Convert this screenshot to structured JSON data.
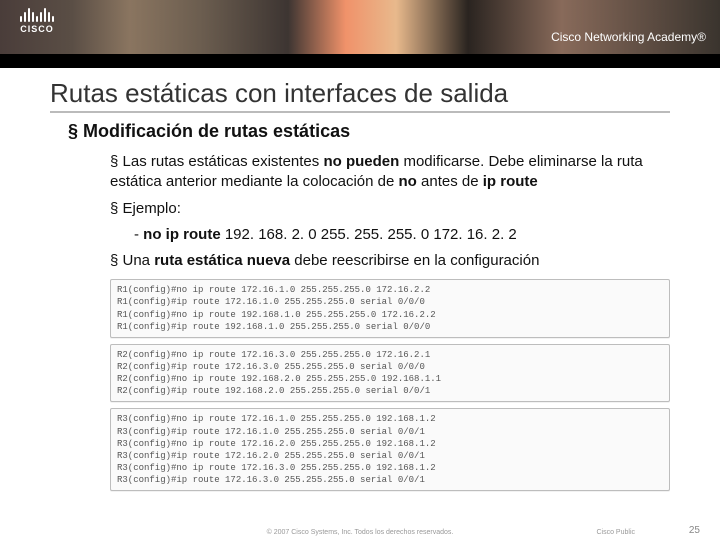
{
  "banner": {
    "logo_text": "CISCO",
    "academy": "Cisco Networking Academy®"
  },
  "slide": {
    "title": "Rutas estáticas con interfaces de salida",
    "subtitle": "Modificación de rutas estáticas"
  },
  "bullets": {
    "b1_prefix": "§ Las rutas estáticas existentes ",
    "b1_bold1": "no pueden",
    "b1_mid": " modificarse. Debe eliminarse la ruta estática anterior mediante la colocación de ",
    "b1_bold2": "no",
    "b1_mid2": " antes de ",
    "b1_bold3": "ip route",
    "b2": "§ Ejemplo:",
    "b2_sub_dash": "- ",
    "b2_sub_cmd": "no ip route",
    "b2_sub_rest": " 192. 168. 2. 0 255. 255. 255. 0 172. 16. 2. 2",
    "b3_prefix": "§ Una ",
    "b3_bold": "ruta estática nueva",
    "b3_rest": " debe reescribirse en la configuración"
  },
  "terminals": [
    [
      "R1(config)#no ip route 172.16.1.0 255.255.255.0 172.16.2.2",
      "R1(config)#ip route 172.16.1.0 255.255.255.0 serial 0/0/0",
      "R1(config)#no ip route 192.168.1.0 255.255.255.0 172.16.2.2",
      "R1(config)#ip route 192.168.1.0 255.255.255.0 serial 0/0/0"
    ],
    [
      "R2(config)#no ip route 172.16.3.0 255.255.255.0 172.16.2.1",
      "R2(config)#ip route 172.16.3.0 255.255.255.0 serial 0/0/0",
      "R2(config)#no ip route 192.168.2.0 255.255.255.0 192.168.1.1",
      "R2(config)#ip route 192.168.2.0 255.255.255.0 serial 0/0/1"
    ],
    [
      "R3(config)#no ip route 172.16.1.0 255.255.255.0 192.168.1.2",
      "R3(config)#ip route 172.16.1.0 255.255.255.0 serial 0/0/1",
      "R3(config)#no ip route 172.16.2.0 255.255.255.0 192.168.1.2",
      "R3(config)#ip route 172.16.2.0 255.255.255.0 serial 0/0/1",
      "R3(config)#no ip route 172.16.3.0 255.255.255.0 192.168.1.2",
      "R3(config)#ip route 172.16.3.0 255.255.255.0 serial 0/0/1"
    ]
  ],
  "footer": {
    "copyright": "© 2007 Cisco Systems, Inc. Todos los derechos reservados.",
    "public": "Cisco Public",
    "page": "25"
  }
}
